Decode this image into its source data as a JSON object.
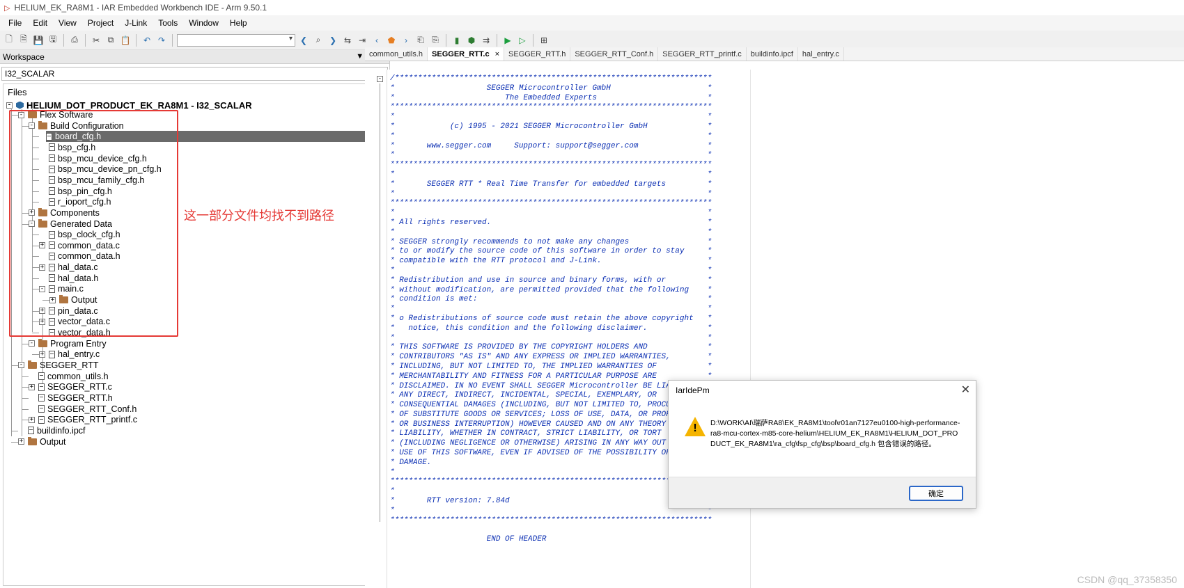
{
  "window": {
    "title": "HELIUM_EK_RA8M1 - IAR Embedded Workbench IDE - Arm 9.50.1"
  },
  "menu": [
    "File",
    "Edit",
    "View",
    "Project",
    "J-Link",
    "Tools",
    "Window",
    "Help"
  ],
  "workspace": {
    "title": "Workspace",
    "config": "I32_SCALAR",
    "files_label": "Files",
    "project": "HELIUM_DOT_PRODUCT_EK_RA8M1 - I32_SCALAR"
  },
  "tree": [
    {
      "label": "Flex Software",
      "type": "folder",
      "expander": "-"
    },
    {
      "label": "Build Configuration",
      "type": "folder",
      "expander": "-"
    },
    {
      "label": "board_cfg.h",
      "type": "file",
      "expander": "",
      "selected": true
    },
    {
      "label": "bsp_cfg.h",
      "type": "file",
      "expander": ""
    },
    {
      "label": "bsp_mcu_device_cfg.h",
      "type": "file",
      "expander": ""
    },
    {
      "label": "bsp_mcu_device_pn_cfg.h",
      "type": "file",
      "expander": ""
    },
    {
      "label": "bsp_mcu_family_cfg.h",
      "type": "file",
      "expander": ""
    },
    {
      "label": "bsp_pin_cfg.h",
      "type": "file",
      "expander": ""
    },
    {
      "label": "r_ioport_cfg.h",
      "type": "file",
      "expander": ""
    },
    {
      "label": "Components",
      "type": "folder",
      "expander": "+"
    },
    {
      "label": "Generated Data",
      "type": "folder",
      "expander": "-"
    },
    {
      "label": "bsp_clock_cfg.h",
      "type": "file",
      "expander": ""
    },
    {
      "label": "common_data.c",
      "type": "file",
      "expander": "+"
    },
    {
      "label": "common_data.h",
      "type": "file",
      "expander": ""
    },
    {
      "label": "hal_data.c",
      "type": "file",
      "expander": "+"
    },
    {
      "label": "hal_data.h",
      "type": "file",
      "expander": ""
    },
    {
      "label": "main.c",
      "type": "file",
      "expander": "-"
    },
    {
      "label": "Output",
      "type": "folder",
      "expander": "+"
    },
    {
      "label": "pin_data.c",
      "type": "file",
      "expander": "+"
    },
    {
      "label": "vector_data.c",
      "type": "file",
      "expander": "+"
    },
    {
      "label": "vector_data.h",
      "type": "file",
      "expander": ""
    },
    {
      "label": "Program Entry",
      "type": "folder",
      "expander": "-"
    },
    {
      "label": "hal_entry.c",
      "type": "file",
      "expander": "+"
    },
    {
      "label": "SEGGER_RTT",
      "type": "folder",
      "expander": "-"
    },
    {
      "label": "common_utils.h",
      "type": "file",
      "expander": ""
    },
    {
      "label": "SEGGER_RTT.c",
      "type": "file",
      "expander": "+"
    },
    {
      "label": "SEGGER_RTT.h",
      "type": "file",
      "expander": ""
    },
    {
      "label": "SEGGER_RTT_Conf.h",
      "type": "file",
      "expander": ""
    },
    {
      "label": "SEGGER_RTT_printf.c",
      "type": "file",
      "expander": "+"
    },
    {
      "label": "buildinfo.ipcf",
      "type": "file",
      "expander": ""
    },
    {
      "label": "Output",
      "type": "folder",
      "expander": "+"
    }
  ],
  "annotation": "这一部分文件均找不到路径",
  "tabs": [
    {
      "label": "common_utils.h",
      "active": false
    },
    {
      "label": "SEGGER_RTT.c",
      "active": true
    },
    {
      "label": "SEGGER_RTT.h",
      "active": false
    },
    {
      "label": "SEGGER_RTT_Conf.h",
      "active": false
    },
    {
      "label": "SEGGER_RTT_printf.c",
      "active": false
    },
    {
      "label": "buildinfo.ipcf",
      "active": false
    },
    {
      "label": "hal_entry.c",
      "active": false
    }
  ],
  "tab_close": "×",
  "code_lines": [
    "/*********************************************************************",
    "*                    SEGGER Microcontroller GmbH                     *",
    "*                        The Embedded Experts                        *",
    "**********************************************************************",
    "*                                                                    *",
    "*            (c) 1995 - 2021 SEGGER Microcontroller GmbH             *",
    "*                                                                    *",
    "*       www.segger.com     Support: support@segger.com               *",
    "*                                                                    *",
    "**********************************************************************",
    "*                                                                    *",
    "*       SEGGER RTT * Real Time Transfer for embedded targets         *",
    "*                                                                    *",
    "**********************************************************************",
    "*                                                                    *",
    "* All rights reserved.                                               *",
    "*                                                                    *",
    "* SEGGER strongly recommends to not make any changes                 *",
    "* to or modify the source code of this software in order to stay     *",
    "* compatible with the RTT protocol and J-Link.                       *",
    "*                                                                    *",
    "* Redistribution and use in source and binary forms, with or         *",
    "* without modification, are permitted provided that the following    *",
    "* condition is met:                                                  *",
    "*                                                                    *",
    "* o Redistributions of source code must retain the above copyright   *",
    "*   notice, this condition and the following disclaimer.             *",
    "*                                                                    *",
    "* THIS SOFTWARE IS PROVIDED BY THE COPYRIGHT HOLDERS AND             *",
    "* CONTRIBUTORS \"AS IS\" AND ANY EXPRESS OR IMPLIED WARRANTIES,        *",
    "* INCLUDING, BUT NOT LIMITED TO, THE IMPLIED WARRANTIES OF           *",
    "* MERCHANTABILITY AND FITNESS FOR A PARTICULAR PURPOSE ARE           *",
    "* DISCLAIMED. IN NO EVENT SHALL SEGGER Microcontroller BE LIAB",
    "* ANY DIRECT, INDIRECT, INCIDENTAL, SPECIAL, EXEMPLARY, OR",
    "* CONSEQUENTIAL DAMAGES (INCLUDING, BUT NOT LIMITED TO, PROCUR",
    "* OF SUBSTITUTE GOODS OR SERVICES; LOSS OF USE, DATA, OR PROFI",
    "* OR BUSINESS INTERRUPTION) HOWEVER CAUSED AND ON ANY THEORY O",
    "* LIABILITY, WHETHER IN CONTRACT, STRICT LIABILITY, OR TORT",
    "* (INCLUDING NEGLIGENCE OR OTHERWISE) ARISING IN ANY WAY OUT O",
    "* USE OF THIS SOFTWARE, EVEN IF ADVISED OF THE POSSIBILITY OF",
    "* DAMAGE.",
    "*",
    "*************************************************************",
    "*",
    "*       RTT version: 7.84d",
    "*                                                                    *",
    "**********************************************************************",
    "",
    "                     END OF HEADER"
  ],
  "dialog": {
    "title": "IarIdePm",
    "close": "✕",
    "icon_glyph": "!",
    "message": "D:\\WORK\\AI\\瑞萨RA8\\EK_RA8M1\\tool\\r01an7127eu0100-high-performance-ra8-mcu-cortex-m85-core-helium\\HELIUM_EK_RA8M1\\HELIUM_DOT_PRODUCT_EK_RA8M1\\ra_cfg\\fsp_cfg\\bsp\\board_cfg.h 包含错误的路径。",
    "ok": "确定"
  },
  "watermark": "CSDN @qq_37358350",
  "icons": {
    "title_icon": "iar-logo-icon",
    "warning": "warning-icon",
    "gear": "gear-icon"
  }
}
